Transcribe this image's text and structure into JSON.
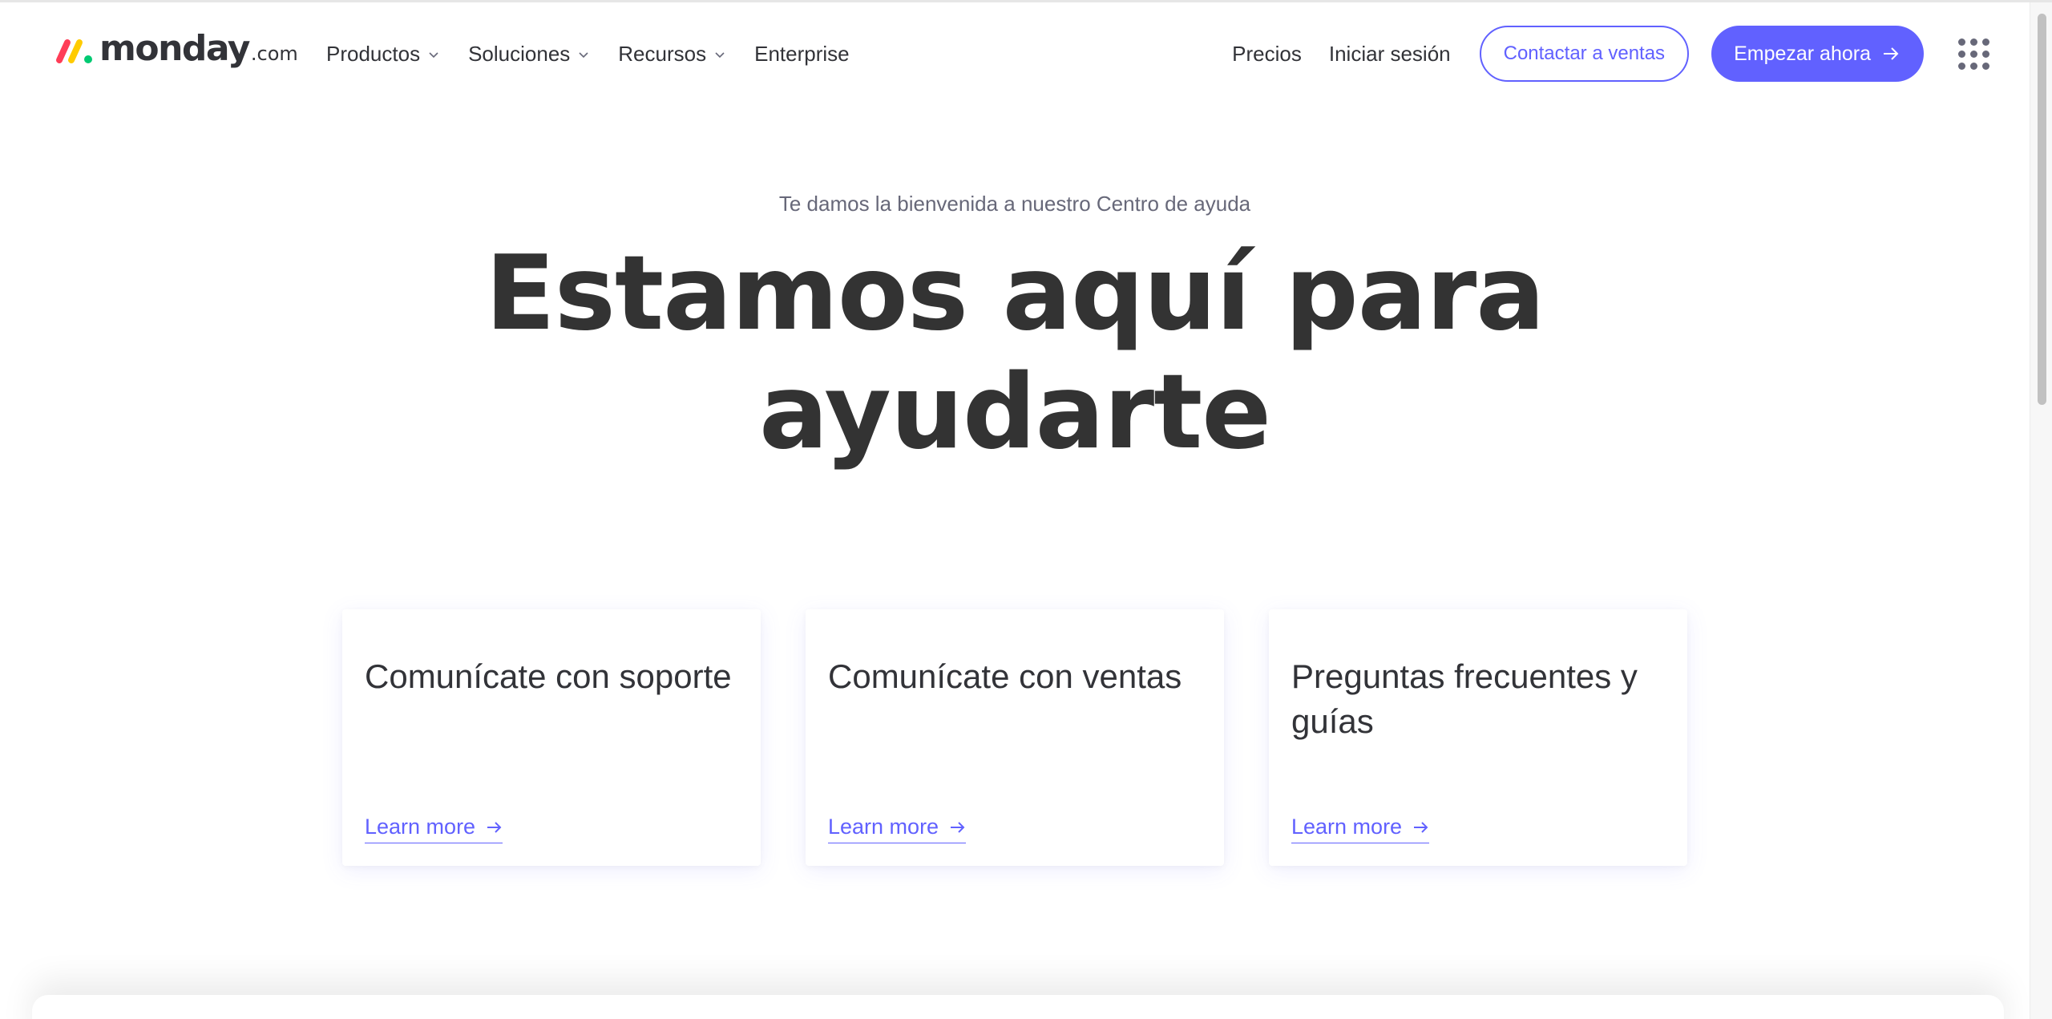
{
  "brand": {
    "wordmark": "monday",
    "tld": ".com",
    "logo_colors": [
      "#ff3d57",
      "#ffcb00",
      "#00ca72"
    ]
  },
  "nav": {
    "left": [
      {
        "label": "Productos",
        "has_dropdown": true
      },
      {
        "label": "Soluciones",
        "has_dropdown": true
      },
      {
        "label": "Recursos",
        "has_dropdown": true
      },
      {
        "label": "Enterprise",
        "has_dropdown": false
      }
    ],
    "pricing": "Precios",
    "login": "Iniciar sesión",
    "contact_sales": "Contactar a ventas",
    "get_started": "Empezar ahora",
    "apps_icon": "grid-apps-icon"
  },
  "hero": {
    "subtitle": "Te damos la bienvenida a nuestro Centro de ayuda",
    "title_line1": "Estamos aquí para",
    "title_line2": "ayudarte"
  },
  "cards": [
    {
      "title": "Comunícate con soporte",
      "link": "Learn more"
    },
    {
      "title": "Comunícate con ventas",
      "link": "Learn more"
    },
    {
      "title": "Preguntas frecuentes y guías",
      "link": "Learn more"
    }
  ],
  "colors": {
    "accent": "#6161ff",
    "text": "#323338",
    "muted": "#676879"
  }
}
